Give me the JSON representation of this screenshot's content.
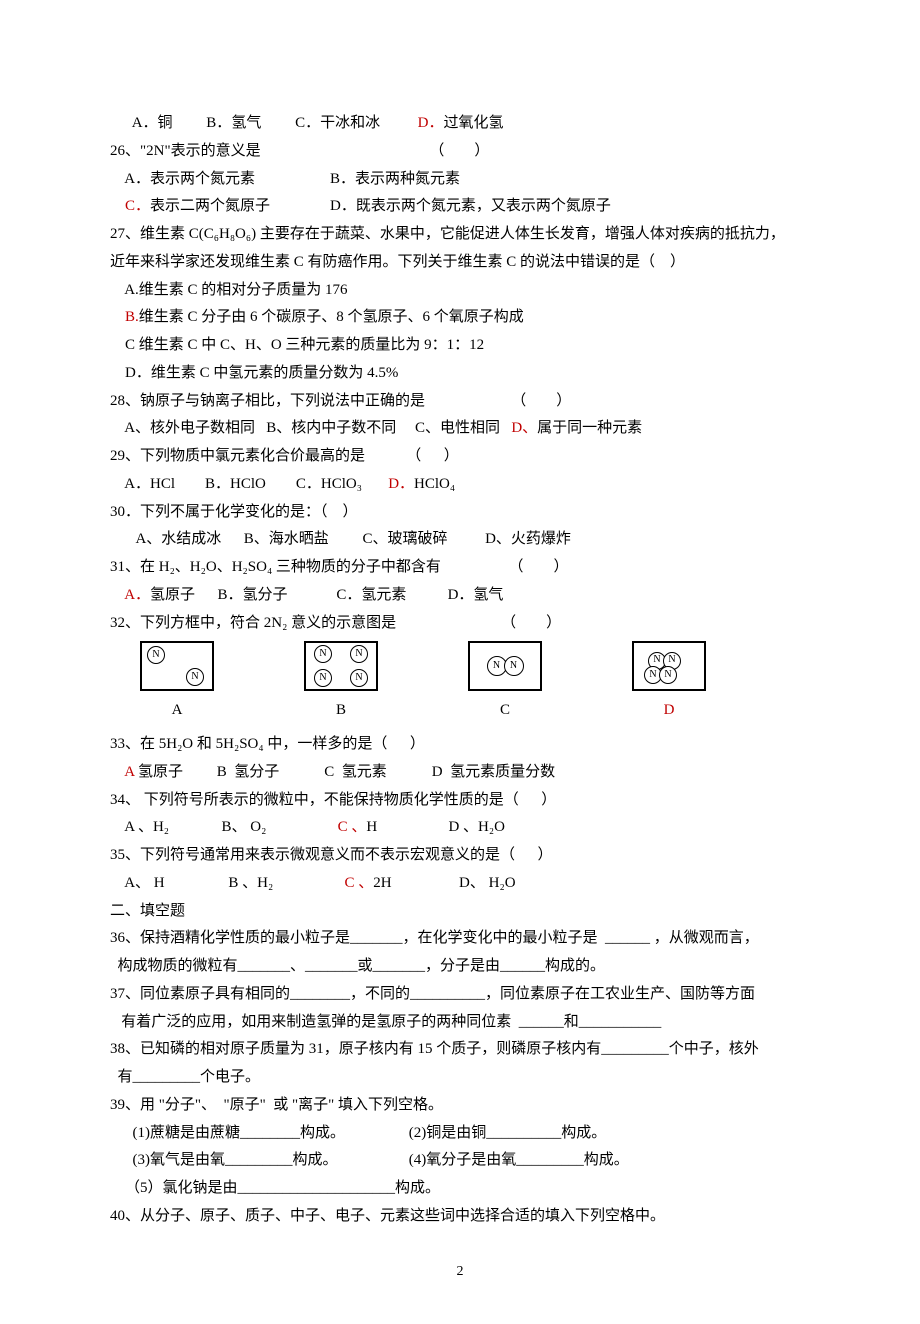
{
  "q25": {
    "optA_label": "A．",
    "optA_text": "铜",
    "optB_label": "B．",
    "optB_text": "氢气",
    "optC_label": "C．",
    "optC_text": "干冰和冰",
    "optD_label": "D．",
    "optD_text": "过氧化氢"
  },
  "q26": {
    "stem": "26、\"2N\"表示的意义是",
    "paren": "（        ）",
    "optA": "A．表示两个氮元素",
    "optB": "B．表示两种氮元素",
    "optC_label": "C．",
    "optC_text": "表示二两个氮原子",
    "optD": "D．既表示两个氮元素，又表示两个氮原子"
  },
  "q27": {
    "line1": "27、维生素 C(C₆H₈O₆) 主要存在于蔬菜、水果中，它能促进人体生长发育，增强人体对疾病的抵抗力，",
    "line2": "近年来科学家还发现维生素 C 有防癌作用。下列关于维生素 C 的说法中错误的是（    ）",
    "optA": "A.维生素 C 的相对分子质量为 176",
    "optB_label": "B.",
    "optB_text": "维生素 C 分子由 6 个碳原子、8 个氢原子、6 个氧原子构成",
    "optC": "C 维生素 C 中 C、H、O 三种元素的质量比为 9：1：12",
    "optD": "D．维生素 C 中氢元素的质量分数为 4.5%"
  },
  "q28": {
    "stem": "28、钠原子与钠离子相比，下列说法中正确的是",
    "paren": "（        ）",
    "optA": "A、核外电子数相同",
    "optB": "B、核内中子数不同",
    "optC": "C、电性相同",
    "optD_label": "D、",
    "optD_text": "属于同一种元素"
  },
  "q29": {
    "stem": "29、下列物质中氯元素化合价最高的是",
    "paren": "（      ）",
    "optA": "A．HCl",
    "optB": "B．HClO",
    "optC": "C．HClO₃",
    "optD_label": "D．",
    "optD_text": "HClO₄"
  },
  "q30": {
    "stem": "30．下列不属于化学变化的是：（    ）",
    "optA": "A、水结成冰",
    "optB": "B、海水晒盐",
    "optC": "C、玻璃破碎",
    "optD": "D、火药爆炸"
  },
  "q31": {
    "stem": "31、在 H₂、H₂O、H₂SO₄ 三种物质的分子中都含有",
    "paren": "（        ）",
    "optA_label": "A．",
    "optA_text": "氢原子",
    "optB": "B．氢分子",
    "optC": "C．氢元素",
    "optD": "D．氢气"
  },
  "q32": {
    "stem": "32、下列方框中，符合 2N₂ 意义的示意图是",
    "paren": "（        ）",
    "labelA": "A",
    "labelB": "B",
    "labelC": "C",
    "labelD": "D"
  },
  "q33": {
    "stem": "33、在 5H₂O 和 5H₂SO₄ 中，一样多的是（      ）",
    "optA_label": "A",
    "optA_text": " 氢原子",
    "optB": "B  氢分子",
    "optC": "C  氢元素",
    "optD": "D  氢元素质量分数"
  },
  "q34": {
    "stem": "34、 下列符号所表示的微粒中，不能保持物质化学性质的是（      ）",
    "optA": "A 、H₂",
    "optB": "B、 O₂",
    "optC_label": "C 、",
    "optC_text": "H",
    "optD": "D 、H₂O"
  },
  "q35": {
    "stem": "35、下列符号通常用来表示微观意义而不表示宏观意义的是（      ）",
    "optA": "A、 H",
    "optB": "B 、H₂",
    "optC_label": "C 、",
    "optC_text": "2H",
    "optD": "D、 H₂O"
  },
  "section2": "二、填空题",
  "q36": {
    "line1": "36、保持酒精化学性质的最小粒子是_______，在化学变化中的最小粒子是  ______ ，从微观而言，",
    "line2": "  构成物质的微粒有_______、_______或_______，分子是由______构成的。"
  },
  "q37": {
    "line1": "37、同位素原子具有相同的________，不同的__________，同位素原子在工农业生产、国防等方面",
    "line2": "   有着广泛的应用，如用来制造氢弹的是氢原子的两种同位素  ______和___________"
  },
  "q38": {
    "line1": "38、已知磷的相对原子质量为 31，原子核内有 15 个质子，则磷原子核内有_________个中子，核外",
    "line2": "  有_________个电子。"
  },
  "q39": {
    "stem": "39、用 \"分子\"、  \"原子\"  或 \"离子\" 填入下列空格。",
    "s1": "(1)蔗糖是由蔗糖________构成。",
    "s2": "(2)铜是由铜__________构成。",
    "s3": "(3)氧气是由氧_________构成。",
    "s4": "(4)氧分子是由氧_________构成。",
    "s5": "（5）氯化钠是由_____________________构成。"
  },
  "q40": "40、从分子、原子、质子、中子、电子、元素这些词中选择合适的填入下列空格中。",
  "pagenum": "2"
}
